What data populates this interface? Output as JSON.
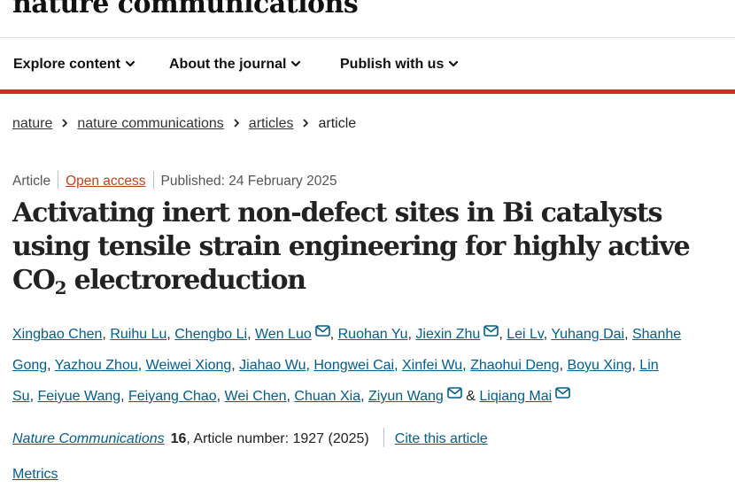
{
  "journal": {
    "name": "nature communications"
  },
  "nav": {
    "items": [
      {
        "label": "Explore content"
      },
      {
        "label": "About the journal"
      },
      {
        "label": "Publish with us"
      }
    ]
  },
  "breadcrumb": {
    "items": [
      {
        "label": "nature"
      },
      {
        "label": "nature communications"
      },
      {
        "label": "articles"
      },
      {
        "label": "article"
      }
    ]
  },
  "meta": {
    "type": "Article",
    "access": "Open access",
    "published": "Published: 24 February 2025"
  },
  "article": {
    "title_before": "Activating inert non-defect sites in Bi catalysts using tensile strain engineering for highly active CO",
    "title_sub": "2",
    "title_after": " electroreduction"
  },
  "authors": {
    "list": [
      {
        "name": "Xingbao Chen",
        "sep": ", "
      },
      {
        "name": "Ruihu Lu",
        "sep": ", "
      },
      {
        "name": "Chengbo Li",
        "sep": ", "
      },
      {
        "name": "Wen Luo",
        "sep": ", "
      },
      {
        "name": "Ruohan Yu",
        "sep": ", "
      },
      {
        "name": "Jiexin Zhu",
        "sep": ", "
      },
      {
        "name": "Lei Lv",
        "sep": ", "
      },
      {
        "name": "Yuhang Dai",
        "sep": ", "
      },
      {
        "name": "Shanhe Gong",
        "sep": ", "
      },
      {
        "name": "Yazhou Zhou",
        "sep": ", "
      },
      {
        "name": "Weiwei Xiong",
        "sep": ", "
      },
      {
        "name": "Jiahao Wu",
        "sep": ", "
      },
      {
        "name": "Hongwei Cai",
        "sep": ", "
      },
      {
        "name": "Xinfei Wu",
        "sep": ", "
      },
      {
        "name": "Zhaohui Deng",
        "sep": ", "
      },
      {
        "name": "Boyu Xing",
        "sep": ", "
      },
      {
        "name": "Lin Su",
        "sep": ", "
      },
      {
        "name": "Feiyue Wang",
        "sep": ", "
      },
      {
        "name": "Feiyang Chao",
        "sep": ", "
      },
      {
        "name": "Wei Chen",
        "sep": ", "
      },
      {
        "name": "Chuan Xia",
        "sep": ", "
      },
      {
        "name": "Ziyun Wang",
        "sep": " & "
      },
      {
        "name": "Liqiang Mai",
        "sep": ""
      }
    ]
  },
  "citation": {
    "journal": "Nature Communications",
    "volume": "16",
    "article_info": ", Article number: 1927 (2025)",
    "cite_link": "Cite this article"
  },
  "metrics": {
    "label": "Metrics"
  },
  "icons": {
    "dropdown": "chevron-down-icon",
    "separator": "chevron-right-icon",
    "contact": "mail-icon"
  },
  "colors": {
    "accent": "#e0261f",
    "link": "#025e8d",
    "open_access": "#c4421b"
  }
}
